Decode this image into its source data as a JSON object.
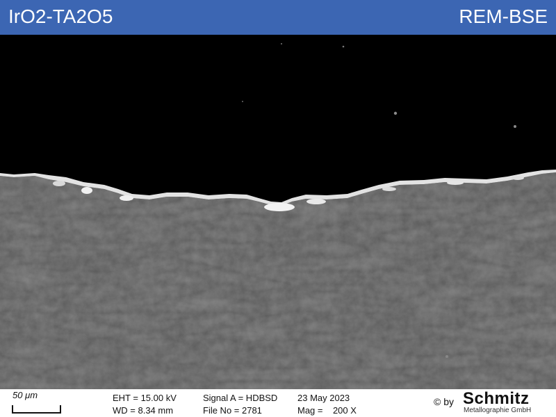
{
  "header": {
    "title": "IrO2-TA2O5",
    "technique": "REM-BSE"
  },
  "databar": {
    "scale_label": "50 μm",
    "eht": "EHT = 15.00 kV",
    "wd": "WD = 8.34 mm",
    "signal": "Signal A = HDBSD",
    "file_no": "File No = 2781",
    "date": "23 May 2023",
    "mag": "Mag =    200 X",
    "copyright": "© by",
    "brand": "Schmitz",
    "brand_sub": "Metallographie GmbH"
  },
  "colors": {
    "header_bg": "#3c66b3",
    "substrate": "#5a5a5a",
    "coating": "#e2e2e2",
    "background": "#000000"
  }
}
